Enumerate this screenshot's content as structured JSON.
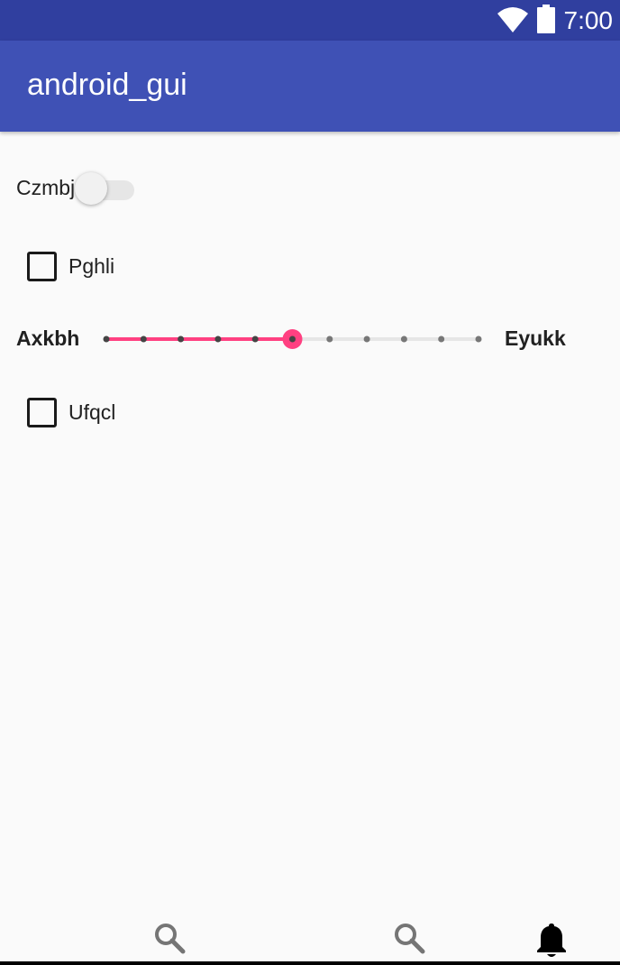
{
  "status_bar": {
    "time": "7:00",
    "wifi_icon": "wifi-icon",
    "battery_icon": "battery-icon",
    "background": "#303f9f"
  },
  "app_bar": {
    "title": "android_gui",
    "background": "#3f51b5"
  },
  "switch": {
    "label": "Czmbj",
    "checked": false
  },
  "checkboxes": [
    {
      "label": "Pghli",
      "checked": false
    },
    {
      "label": "Ufqcl",
      "checked": false
    }
  ],
  "slider": {
    "min_label": "Axkbh",
    "max_label": "Eyukk",
    "steps": 10,
    "value": 5,
    "accent": "#ff4081"
  },
  "bottom_nav": [
    {
      "icon": "search-icon"
    },
    {
      "icon": "search-icon"
    },
    {
      "icon": "bell-icon"
    }
  ]
}
